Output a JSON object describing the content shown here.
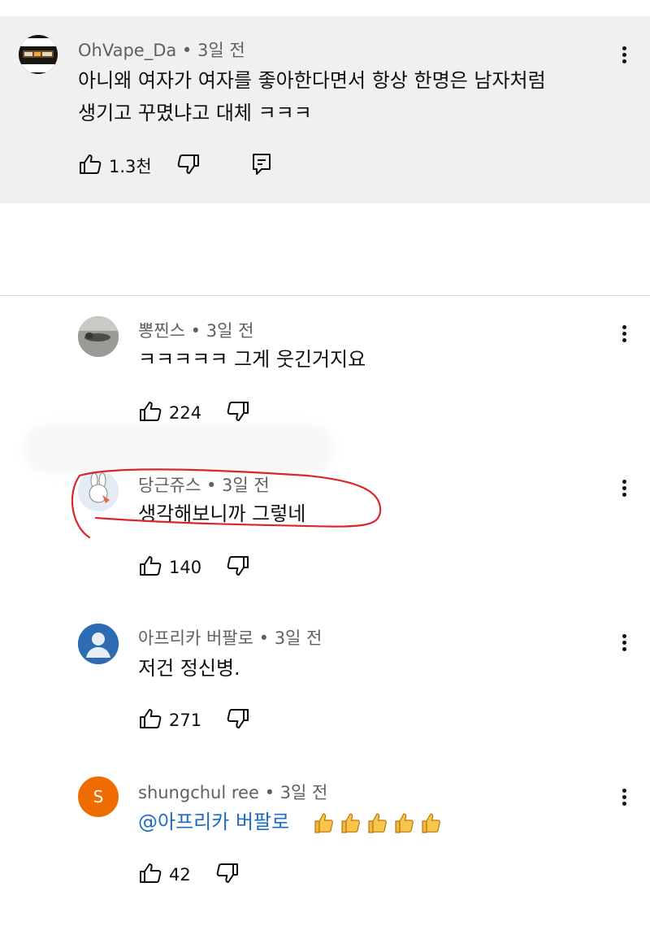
{
  "pinned_comment": {
    "author": "OhVape_Da",
    "time": "3일 전",
    "text_line1": "아니왜 여자가 여자를 좋아한다면서 항상 한명은 남자처럼",
    "text_line2": "생기고 꾸몄냐고 대체 ㅋㅋㅋ",
    "likes": "1.3천",
    "icons": [
      "thumb-up-icon",
      "thumb-down-icon",
      "reply-comment-icon",
      "more-vert-icon"
    ]
  },
  "replies": [
    {
      "author": "뽕찐스",
      "time": "3일 전",
      "text": "ㅋㅋㅋㅋㅋ 그게 웃긴거지요",
      "likes": "224"
    },
    {
      "author": "당근쥬스",
      "time": "3일 전",
      "text": "생각해보니까 그렇네",
      "likes": "140",
      "highlight_color": "#d9262b"
    },
    {
      "author": "아프리카 버팔로",
      "time": "3일 전",
      "text": "저건 정신병.",
      "likes": "271"
    },
    {
      "author": "shungchul ree",
      "time": "3일 전",
      "mention": "@아프리카 버팔로",
      "emoji": "thumbs-up-emoji",
      "emoji_count": 5,
      "avatar_letter": "S",
      "avatar_color": "#ef6c00",
      "likes": "42"
    }
  ],
  "meta_separator": "•",
  "colors": {
    "pinned_bg": "#f0f0f0",
    "meta_text": "#606060",
    "mention": "#1a6cc4"
  }
}
